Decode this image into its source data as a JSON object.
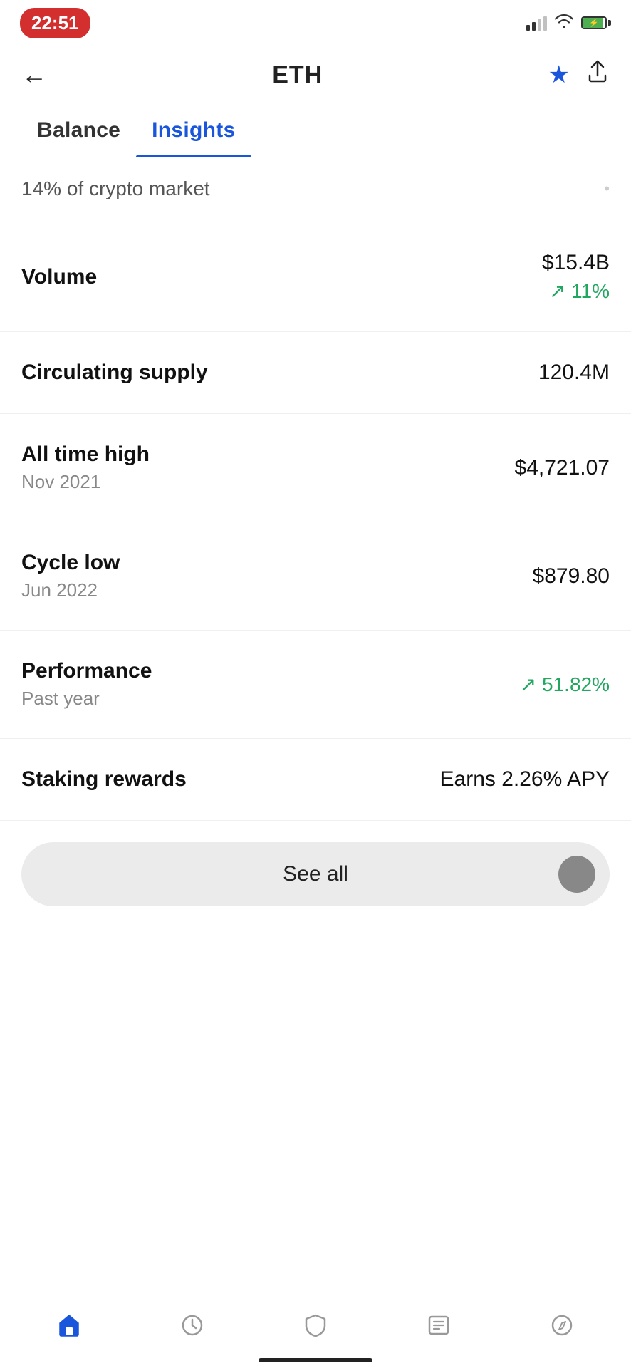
{
  "statusBar": {
    "time": "22:51",
    "battery_level": "90"
  },
  "header": {
    "title": "ETH",
    "backLabel": "←",
    "starLabel": "★",
    "shareLabel": "↑"
  },
  "tabs": [
    {
      "id": "balance",
      "label": "Balance",
      "active": false
    },
    {
      "id": "insights",
      "label": "Insights",
      "active": true
    }
  ],
  "marketCap": {
    "text": "14% of crypto market"
  },
  "stats": [
    {
      "id": "volume",
      "label": "Volume",
      "sublabel": "",
      "value": "$15.4B",
      "change": "↗ 11%",
      "changeType": "positive"
    },
    {
      "id": "circulating-supply",
      "label": "Circulating supply",
      "sublabel": "",
      "value": "120.4M",
      "change": "",
      "changeType": ""
    },
    {
      "id": "all-time-high",
      "label": "All time high",
      "sublabel": "Nov 2021",
      "value": "$4,721.07",
      "change": "",
      "changeType": ""
    },
    {
      "id": "cycle-low",
      "label": "Cycle low",
      "sublabel": "Jun 2022",
      "value": "$879.80",
      "change": "",
      "changeType": ""
    },
    {
      "id": "performance",
      "label": "Performance",
      "sublabel": "Past year",
      "value": "",
      "change": "↗ 51.82%",
      "changeType": "positive"
    },
    {
      "id": "staking-rewards",
      "label": "Staking rewards",
      "sublabel": "",
      "value": "Earns 2.26% APY",
      "change": "",
      "changeType": ""
    }
  ],
  "seeAll": {
    "label": "See all"
  },
  "bottomNav": [
    {
      "id": "home",
      "icon": "home",
      "active": true
    },
    {
      "id": "portfolio",
      "icon": "clock",
      "active": false
    },
    {
      "id": "shield",
      "icon": "shield",
      "active": false
    },
    {
      "id": "orders",
      "icon": "list",
      "active": false
    },
    {
      "id": "explore",
      "icon": "compass",
      "active": false
    }
  ]
}
